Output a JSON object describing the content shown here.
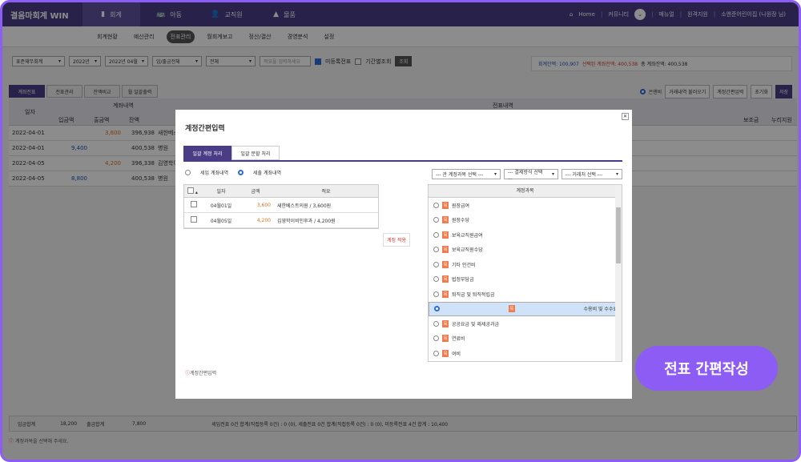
{
  "brand": "결음마회계 WIN",
  "menu": [
    {
      "label": "회계",
      "icon": "▮"
    },
    {
      "label": "아동",
      "icon": "🚌"
    },
    {
      "label": "교직원",
      "icon": "👤"
    },
    {
      "label": "물품",
      "icon": "▲"
    }
  ],
  "top_right": {
    "home": "Home",
    "community": "커뮤니티",
    "manual": "매뉴얼",
    "remote": "원격지원",
    "user": "소엔준어린이집 (나원장 님)"
  },
  "subnav": [
    "회계현황",
    "예산관리",
    "전표관리",
    "월회계보고",
    "정산/결산",
    "경영분석",
    "설정"
  ],
  "filter": {
    "ledger": "표준재무회계",
    "year": "2022년",
    "month": "2022년 04월",
    "type": "입/출금전체",
    "all": "전체",
    "placeholder": "적요을 입력하세요",
    "unreg": "미등록전표",
    "period": "기간별조회",
    "search": "조회"
  },
  "balance": {
    "account": "회계잔액: 100,907",
    "selected": "선택된 계좌잔액: 400,538",
    "total": "총 계좌잔액: 400,538"
  },
  "tabs": [
    "계좌전표",
    "전표관리",
    "잔액비교",
    "월 일괄출력"
  ],
  "rtools": {
    "radio": "은엔비",
    "import": "거래내역 불러오기",
    "simple": "계정간편입력",
    "reset": "초기화",
    "save": "저장"
  },
  "grid": {
    "h_date": "일자",
    "h_account": "계좌내역",
    "h_in": "입금액",
    "h_out": "출금액",
    "h_bal": "잔액",
    "h_slip": "전표내역",
    "h_sub": "보조금",
    "h_nuri": "누리지원",
    "rows": [
      {
        "date": "2022-04-01",
        "in": "",
        "out": "3,600",
        "bal": "396,938",
        "memo": "새한베스트"
      },
      {
        "date": "2022-04-01",
        "in": "9,400",
        "out": "",
        "bal": "400,538",
        "memo": "병원"
      },
      {
        "date": "2022-04-05",
        "in": "",
        "out": "4,200",
        "bal": "396,338",
        "memo": "김영학이비"
      },
      {
        "date": "2022-04-05",
        "in": "8,800",
        "out": "",
        "bal": "400,538",
        "memo": "병원"
      }
    ]
  },
  "footer": {
    "in_label": "입금합계",
    "in_val": "18,200",
    "out_label": "출금합계",
    "out_val": "7,800",
    "summary": "세입전표 0건 합계(직접등록 0건) : 0 (0), 세출전표 0건 합계(직접등록 0건) : 0 (0), 미등록전표 4건 합계 : 10,400"
  },
  "note": "계정과목을 선택해 주세요.",
  "modal": {
    "title": "계정간편입력",
    "tabs": [
      "일괄 계정 처리",
      "일괄 분할 처리"
    ],
    "radio_in": "세입 계좌내역",
    "radio_out": "세출 계좌내역",
    "cols": {
      "date": "일자",
      "amount": "금액",
      "memo": "적요"
    },
    "rows": [
      {
        "date": "04월01일",
        "amount": "3,600",
        "memo": "새한베스트의원 / 3,600원"
      },
      {
        "date": "04월05일",
        "amount": "4,200",
        "memo": "김영학이비인후과 / 4,200원"
      }
    ],
    "apply": "계정 적용",
    "dd": [
      "--- 관 계정과목 선택 ---",
      "--- 결제방식 선택 ...",
      "--- 거래처 선택 ---"
    ],
    "list_header": "계정과목",
    "items": [
      "원장급여",
      "원장수당",
      "보육교직원급여",
      "보육교직원수당",
      "기타 인건비",
      "법정부담금",
      "퇴직금 및 퇴직적립금",
      "수용비 및 수수료",
      "공공요금 및 제세공과금",
      "연료비",
      "여비"
    ],
    "selected_index": 7,
    "tag": "목",
    "note": "계정간편입력"
  },
  "bubble": "전표 간편작성"
}
